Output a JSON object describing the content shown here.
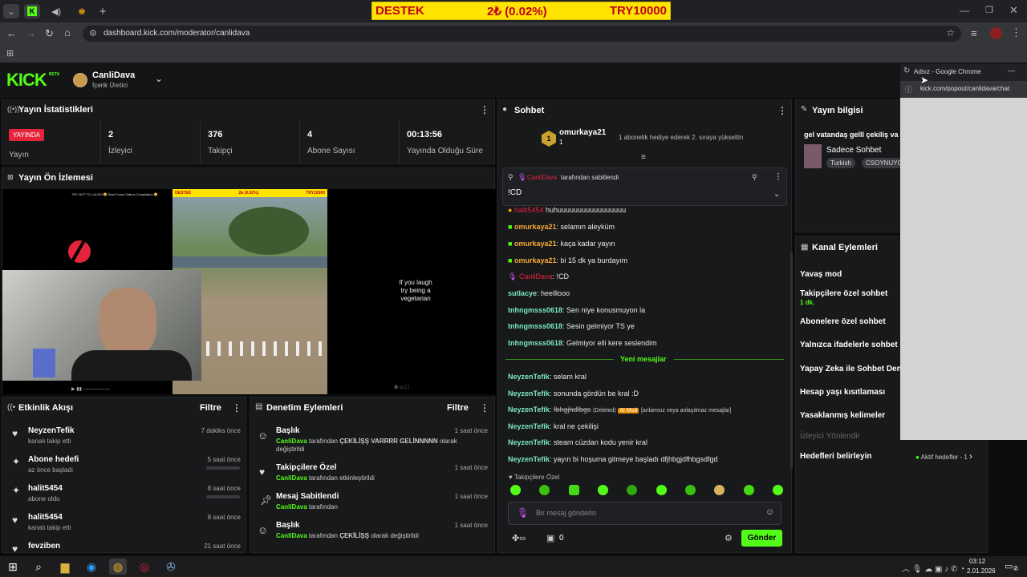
{
  "browser": {
    "banner": {
      "left": "DESTEK",
      "mid": "2₺ (0.02%)",
      "right": "TRY10000"
    },
    "url": "dashboard.kick.com/moderator/canlidava",
    "new_tab": "+"
  },
  "kick": {
    "logo": "KICK",
    "beta": "BETA",
    "channel_name": "CanliDava",
    "channel_role": "İçerik Üretici"
  },
  "stats": {
    "title": "Yayın İstatistikleri",
    "live_badge": "YAYINDA",
    "live_label": "Yayın",
    "items": [
      {
        "value": "2",
        "label": "İzleyici"
      },
      {
        "value": "376",
        "label": "Takipçi"
      },
      {
        "value": "4",
        "label": "Abone Sayısı"
      },
      {
        "value": "00:13:56",
        "label": "Yayında Olduğu Süre"
      }
    ]
  },
  "preview": {
    "title": "Yayın Ön İzlemesi",
    "video_top_text": "TRY NOT TO LAUGH 😂 Best Funny Videos Compilation 😂",
    "mini_banner": {
      "left": "DESTEK",
      "mid": "2₺ (0.02%)",
      "right": "TRY10000"
    },
    "side_text": "If you laugh try being a vegetarian"
  },
  "chat": {
    "title": "Sohbet",
    "top_user": "omurkaya21",
    "top_user_count": "1",
    "top_message": "1 abonelik hediye ederek 2. sıraya yükseltin",
    "pinned_by": "CanliDava",
    "pinned_suffix": "tarafından sabitlendi",
    "pinned_text": "!CD",
    "partial_line_user": "halit5454",
    "partial_line_text": "huhuuuuuuuuuuuuuuuuu",
    "messages": [
      {
        "user": "omurkaya21",
        "text": "selamın aleyküm"
      },
      {
        "user": "omurkaya21",
        "text": "kaça kadar yayın"
      },
      {
        "user": "omurkaya21",
        "text": "bi 15 dk ya burdayım"
      },
      {
        "user": "CanliDava",
        "text": "!CD"
      },
      {
        "user": "sutlacye",
        "text": "heelllooo"
      },
      {
        "user": "tnhngmsss0618",
        "text": "Sen niye konusmuyon la"
      },
      {
        "user": "tnhngmsss0618",
        "text": "Sesin gelmiyor TS ye"
      },
      {
        "user": "tnhngmsss0618",
        "text": "Gelmiyor elli kere seslendim"
      }
    ],
    "new_messages_label": "Yeni mesajlar",
    "new_messages": [
      {
        "user": "NeyzenTefik",
        "text": "selam kral"
      },
      {
        "user": "NeyzenTefik",
        "text": "sonunda gördün be kral :D"
      },
      {
        "user": "NeyzenTefik",
        "text": "fbhgjhdfbgs",
        "deleted": "(Deleted)",
        "ai": "AI Mod",
        "reason": "[anlamsız veya anlaşılmaz mesajlar]"
      },
      {
        "user": "NeyzenTefik",
        "text": "kral ne çekilişi"
      },
      {
        "user": "NeyzenTefik",
        "text": "steam cüzdan kodu yenir kral"
      },
      {
        "user": "NeyzenTefik",
        "text": "yayın bi hoşuma gitmeye başladı dfjhbgjdfhbgsdfgd"
      }
    ],
    "followers_only": "Takipçilere Özel",
    "input_placeholder": "Bir mesaj gönderin",
    "points": "0",
    "send_label": "Gönder"
  },
  "activity": {
    "title": "Etkinlik Akışı",
    "filter": "Filtre",
    "items": [
      {
        "title": "NeyzenTefik",
        "sub": "kanalı takip etti",
        "time": "7 dakika önce"
      },
      {
        "title": "Abone hedefi",
        "sub": "az önce başladı",
        "time": "5 saat önce"
      },
      {
        "title": "halit5454",
        "sub": "abone oldu",
        "time": "8 saat önce"
      },
      {
        "title": "halit5454",
        "sub": "kanalı takip etti",
        "time": "8 saat önce"
      },
      {
        "title": "fevziben",
        "sub": "",
        "time": "21 saat önce"
      }
    ]
  },
  "moderation": {
    "title": "Denetim Eylemleri",
    "filter": "Filtre",
    "items": [
      {
        "title": "Başlık",
        "actor": "CanliDava",
        "pre": "tarafından",
        "bold": "ÇEKİLİŞŞ VARRRR GELİNNNNN",
        "post": "olarak değiştirildi",
        "time": "1 saat önce"
      },
      {
        "title": "Takipçilere Özel",
        "actor": "CanliDava",
        "pre": "tarafından etkinleştirildi",
        "bold": "",
        "post": "",
        "time": "1 saat önce"
      },
      {
        "title": "Mesaj Sabitlendi",
        "actor": "CanliDava",
        "pre": "tarafından",
        "bold": "",
        "post": "",
        "time": "1 saat önce"
      },
      {
        "title": "Başlık",
        "actor": "CanliDava",
        "pre": "tarafından",
        "bold": "ÇEKİLİŞŞ",
        "post": "olarak değiştirildi",
        "time": "1 saat önce"
      }
    ]
  },
  "stream_info": {
    "title": "Yayın bilgisi",
    "stream_title": "gel vatandaş gelll çekiliş va",
    "category": "Sadece Sohbet",
    "tags": [
      "Turkish",
      "CSOYNUYO"
    ]
  },
  "channel_actions": {
    "title": "Kanal Eylemleri",
    "items": [
      {
        "label": "Yavaş mod",
        "sub": ""
      },
      {
        "label": "Takipçilere özel sohbet",
        "sub": "1 dk."
      },
      {
        "label": "Abonelere özel sohbet",
        "sub": ""
      },
      {
        "label": "Yalnızca ifadelerle sohbet",
        "sub": ""
      },
      {
        "label": "Yapay Zeka ile Sohbet Dene",
        "sub": ""
      },
      {
        "label": "Hesap yaşı kısıtlaması",
        "sub": ""
      },
      {
        "label": "Yasaklanmış kelimeler",
        "sub": ""
      },
      {
        "label": "İzleyici Yönlendir",
        "sub": ""
      },
      {
        "label": "Hedefleri belirleyin",
        "sub": ""
      }
    ],
    "active_goals": "Aktif hedefler - 1"
  },
  "popout": {
    "title": "Adsız - Google Chrome",
    "url": "kick.com/popout/canlidava/chat"
  },
  "taskbar": {
    "time": "03:12",
    "date": "2.01.2026",
    "notif_count": "2"
  },
  "colors": {
    "kick_green": "#53fc18",
    "live_red": "#e5243b",
    "banner_yellow": "#ffe400"
  }
}
